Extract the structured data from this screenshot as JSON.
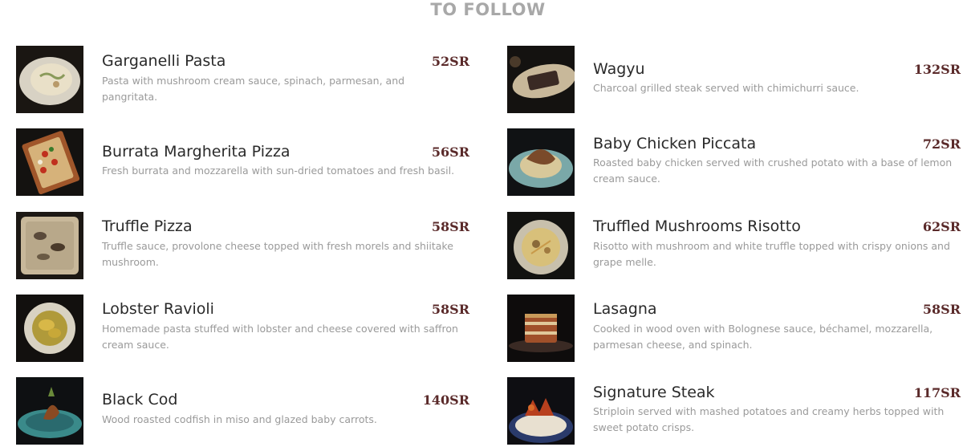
{
  "section": {
    "title": "TO FOLLOW"
  },
  "left_column": [
    {
      "name": "Garganelli Pasta",
      "price": "52SR",
      "description": "Pasta with mushroom cream sauce, spinach, parmesan, and pangritata."
    },
    {
      "name": "Burrata Margherita Pizza",
      "price": "56SR",
      "description": "Fresh burrata and mozzarella with sun-dried tomatoes and fresh basil."
    },
    {
      "name": "Truffle Pizza",
      "price": "58SR",
      "description": "Truffle sauce, provolone cheese topped with fresh morels and shiitake mushroom."
    },
    {
      "name": "Lobster Ravioli",
      "price": "58SR",
      "description": "Homemade pasta stuffed with lobster and cheese covered with saffron cream sauce."
    },
    {
      "name": "Black Cod",
      "price": "140SR",
      "description": "Wood roasted codfish in miso and glazed baby carrots."
    }
  ],
  "right_column": [
    {
      "name": "Wagyu",
      "price": "132SR",
      "description": "Charcoal grilled steak served with chimichurri sauce."
    },
    {
      "name": "Baby Chicken Piccata",
      "price": "72SR",
      "description": "Roasted baby chicken served with crushed potato with a base of lemon cream sauce."
    },
    {
      "name": "Truffled Mushrooms Risotto",
      "price": "62SR",
      "description": "Risotto with mushroom and white truffle topped with crispy onions and grape melle."
    },
    {
      "name": "Lasagna",
      "price": "58SR",
      "description": "Cooked in wood oven with Bolognese sauce, béchamel, mozzarella, parmesan cheese, and spinach."
    },
    {
      "name": "Signature Steak",
      "price": "117SR",
      "description": "Striploin served with mashed potatoes and creamy herbs topped with sweet potato crisps."
    }
  ],
  "colors": {
    "title": "#a8a8a8",
    "name": "#2a2a2a",
    "price": "#5a2a2a",
    "description": "#9a9a9a"
  }
}
